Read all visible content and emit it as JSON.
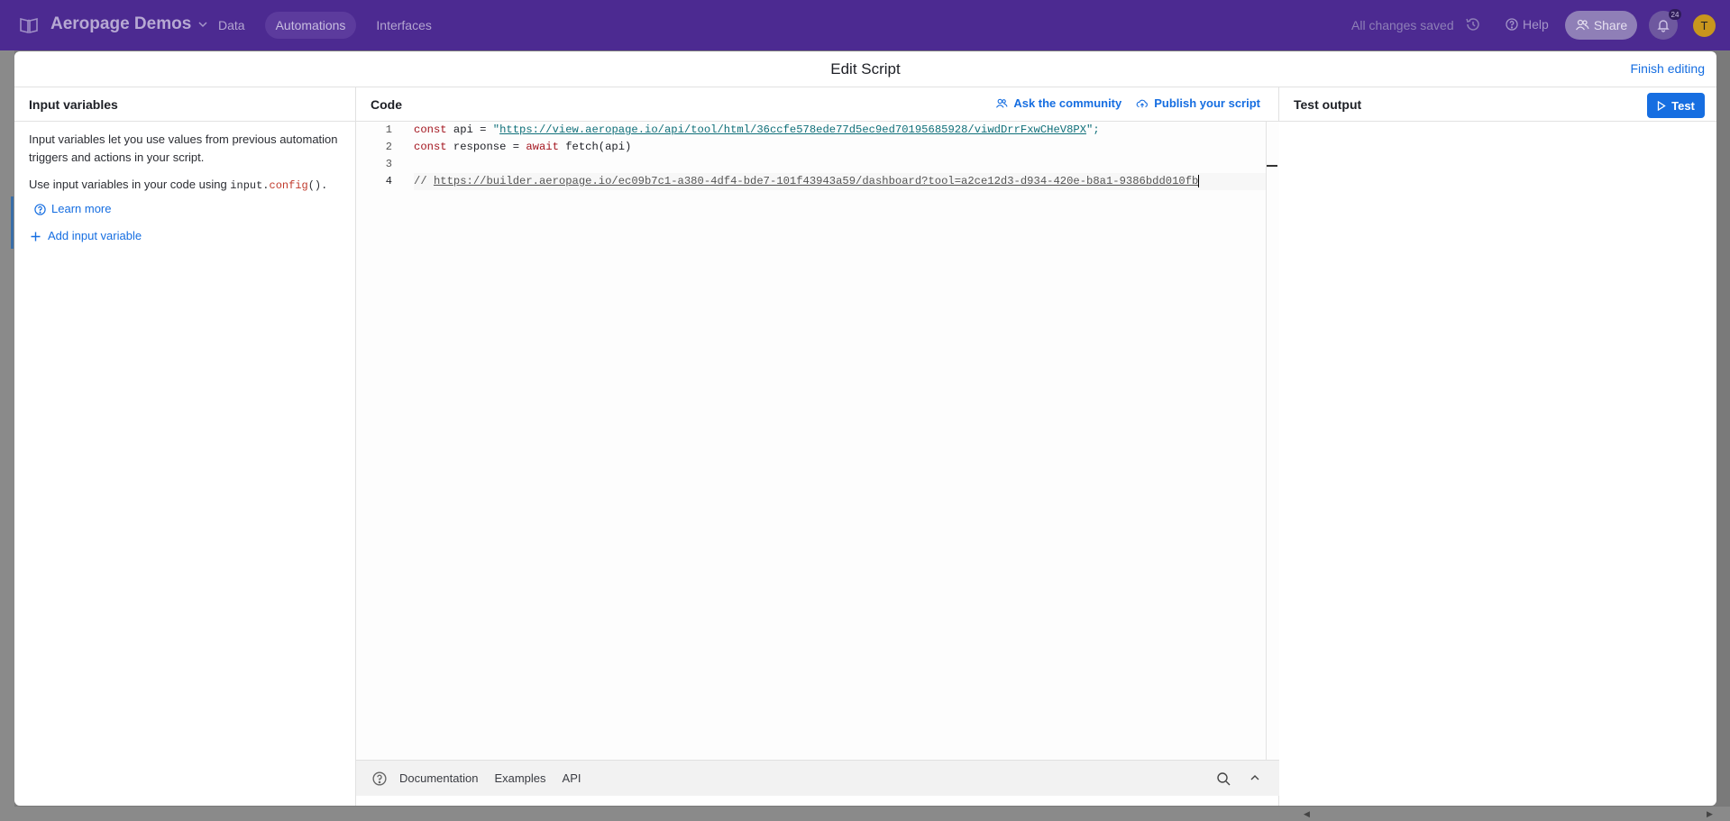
{
  "topbar": {
    "app_title": "Aeropage Demos",
    "nav": [
      "Data",
      "Automations",
      "Interfaces"
    ],
    "status": "All changes saved",
    "help": "Help",
    "share": "Share",
    "notifications_count": "24",
    "avatar_initial": "T"
  },
  "modal": {
    "title": "Edit Script",
    "finish": "Finish editing"
  },
  "input_panel": {
    "heading": "Input variables",
    "description": "Input variables let you use values from previous automation triggers and actions in your script.",
    "usage_prefix": "Use input variables in your code using ",
    "usage_code_obj": "input.",
    "usage_code_fn": "config",
    "usage_code_paren": "().",
    "learn_more": "Learn more",
    "add_variable": "Add input variable"
  },
  "code_panel": {
    "heading": "Code",
    "ask_community": "Ask the community",
    "publish": "Publish your script",
    "line_numbers": [
      "1",
      "2",
      "3",
      "4"
    ],
    "line1": {
      "kw": "const",
      "rest": " api = ",
      "q": "\"",
      "url": "https://view.aeropage.io/api/tool/html/36ccfe578ede77d5ec9ed70195685928/viwdDrrFxwCHeV8PX",
      "tail": "\";"
    },
    "line2": {
      "kw": "const",
      "mid": " response = ",
      "kw2": "await",
      "rest": " fetch(api)"
    },
    "line4": {
      "prefix": "// ",
      "url": "https://builder.aeropage.io/ec09b7c1-a380-4df4-bde7-101f43943a59/dashboard?tool=a2ce12d3-d934-420e-b8a1-9386bdd010fb"
    },
    "footer": [
      "Documentation",
      "Examples",
      "API"
    ]
  },
  "output_panel": {
    "heading": "Test output",
    "test": "Test"
  },
  "colors": {
    "topbar": "#4c2a91",
    "accent": "#166ee1",
    "keyword": "#a3141e",
    "string": "#10707a"
  }
}
